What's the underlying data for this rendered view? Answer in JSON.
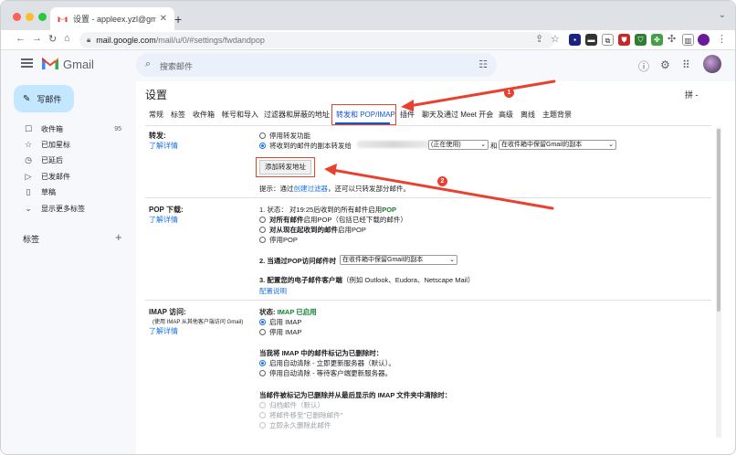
{
  "browser": {
    "tab_title": "设置 - appleex.yzl@gmail.com",
    "tab_close": "✕",
    "new_tab": "+",
    "tab_menu": "⌄",
    "url_host": "mail.google.com",
    "url_path": "/mail/u/0/#settings/fwdandpop"
  },
  "gmail": {
    "brand": "Gmail",
    "search_placeholder": "搜索邮件",
    "compose": "写邮件",
    "nav": [
      {
        "icon": "inbox-icon",
        "glyph": "☐",
        "label": "收件箱",
        "count": "95"
      },
      {
        "icon": "star-icon",
        "glyph": "☆",
        "label": "已加星标",
        "count": ""
      },
      {
        "icon": "clock-icon",
        "glyph": "◷",
        "label": "已延后",
        "count": ""
      },
      {
        "icon": "send-icon",
        "glyph": "▷",
        "label": "已发邮件",
        "count": ""
      },
      {
        "icon": "draft-icon",
        "glyph": "▯",
        "label": "草稿",
        "count": ""
      },
      {
        "icon": "chevron-down-icon",
        "glyph": "⌄",
        "label": "显示更多标签",
        "count": ""
      }
    ],
    "labels_heading": "标签",
    "labels_add": "+"
  },
  "settings": {
    "title": "设置",
    "input_tool": "拼 -",
    "tabs": [
      "常规",
      "标签",
      "收件箱",
      "帐号和导入",
      "过滤器和屏蔽的地址",
      "转发和 POP/IMAP",
      "插件",
      "聊天及通过 Meet 开会",
      "高级",
      "离线",
      "主题背景"
    ],
    "active_tab": "转发和 POP/IMAP",
    "forwarding": {
      "title": "转发:",
      "learn_more": "了解详情",
      "opt_disable": "停用转发功能",
      "opt_forward_prefix": "将收到的邮件的副本转发给",
      "forward_select_tail": "(正在使用)",
      "and": "和",
      "keep_select": "在收件箱中保留Gmail的副本",
      "add_button": "添加转发地址",
      "tip_prefix": "提示：通过",
      "tip_link": "创建过滤器",
      "tip_suffix": "，还可以只转发部分邮件。"
    },
    "pop": {
      "title": "POP 下载:",
      "learn_more": "了解详情",
      "status_prefix": "1. 状态： 对19:25后收到的所有邮件启用",
      "status_value": "POP",
      "opt1_bold": "对所有邮件",
      "opt1_rest": "启用POP（包括已经下载的邮件）",
      "opt2_bold": "对从现在起收到的邮件",
      "opt2_rest": "启用POP",
      "opt3": "停用POP",
      "step2": "2. 当通过POP访问邮件时",
      "step2_select": "在收件箱中保留Gmail的副本",
      "step3_bold": "3. 配置您的电子邮件客户端",
      "step3_rest": "（例如 Outlook、Eudora、Netscape Mail）",
      "config_link": "配置说明"
    },
    "imap": {
      "title": "IMAP 访问:",
      "note": "(使用 IMAP 从其他客户端访问 Gmail)",
      "learn_more": "了解详情",
      "status_prefix": "状态: ",
      "status_value": "IMAP 已启用",
      "enable": "启用 IMAP",
      "disable": "停用 IMAP",
      "delete_heading": "当我将 IMAP 中的邮件标记为已删除时：",
      "auto_expunge_on": "启用自动清除 - 立即更新服务器（默认）。",
      "auto_expunge_off": "停用自动清除 - 等待客户端更新服务器。",
      "expunge_heading": "当邮件被标记为已删除并从最后显示的 IMAP 文件夹中清除时：",
      "archive": "归档邮件（默认）",
      "trash": "将邮件移至\"已删除邮件\"",
      "delete_forever": "立即永久删除此邮件"
    }
  },
  "annotations": {
    "badge1": "1",
    "badge2": "2",
    "color": "#e8412f"
  },
  "colors": {
    "accent": "#0b57d0",
    "link": "#1a73e8",
    "compose_bg": "#c2e7ff",
    "status_green": "#188038"
  }
}
